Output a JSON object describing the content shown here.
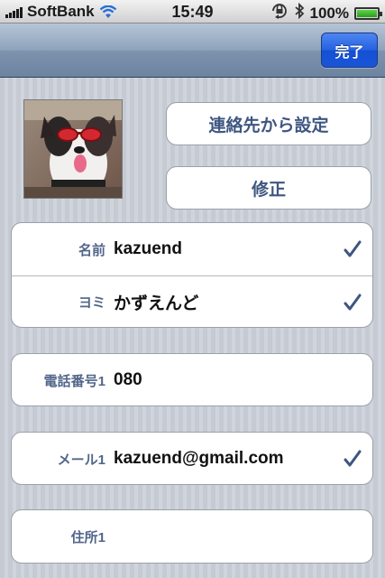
{
  "status_bar": {
    "carrier": "SoftBank",
    "time": "15:49",
    "battery": "100%",
    "battery_level": 1.0,
    "icons": [
      "signal-bars-icon",
      "wifi-icon",
      "orientation-lock-icon",
      "bluetooth-icon",
      "battery-icon"
    ]
  },
  "navbar": {
    "done_label": "完了"
  },
  "actions": {
    "set_from_contacts": "連絡先から設定",
    "edit": "修正"
  },
  "fields": {
    "name": {
      "label": "名前",
      "value": "kazuend",
      "checked": true
    },
    "reading": {
      "label": "ヨミ",
      "value": "かずえんど",
      "checked": true
    },
    "phone": {
      "label": "電話番号1",
      "value": "080",
      "checked": false
    },
    "email": {
      "label": "メール1",
      "value": "kazuend@gmail.com",
      "checked": true
    },
    "address": {
      "label": "住所1",
      "value": "",
      "checked": false
    }
  },
  "colors": {
    "accent_blue": "#2561e0",
    "label_color": "#52668a",
    "check_color": "#3e5680",
    "background": "#c9ced6"
  }
}
